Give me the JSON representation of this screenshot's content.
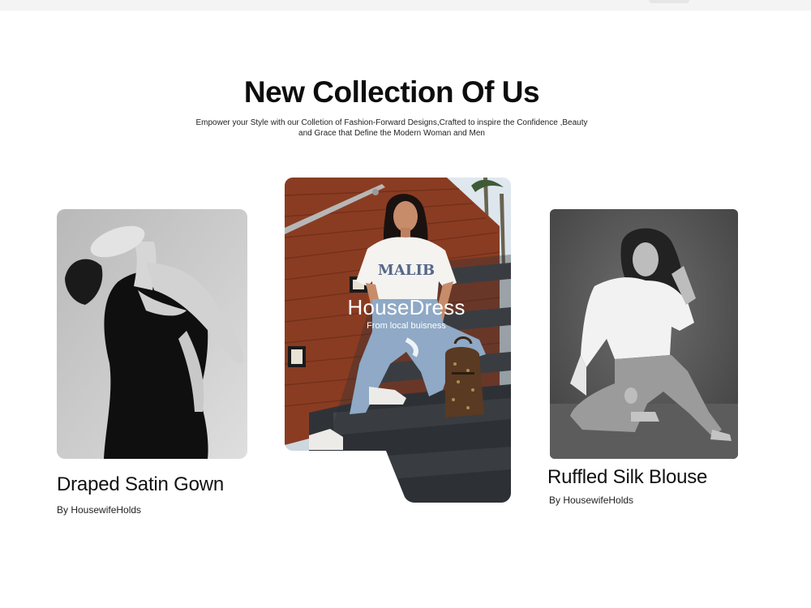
{
  "section": {
    "title": "New Collection Of Us",
    "subtitle_line1": "Empower your Style with our Colletion of Fashion-Forward Designs,Crafted to inspire the Confidence ,Beauty",
    "subtitle_line2": "and Grace that Define the Modern Woman and Men"
  },
  "featured": {
    "title": "HouseDress",
    "subtitle": "From local buisness",
    "shirt_text": "MALIB"
  },
  "products": [
    {
      "name": "Draped Satin Gown",
      "by": "By HousewifeHolds"
    },
    {
      "name": "Ruffled Silk Blouse",
      "by": "By HousewifeHolds"
    }
  ],
  "colors": {
    "text": "#111111",
    "background": "#ffffff",
    "wood": "#8a3c22",
    "stairs": "#3a3d42"
  }
}
